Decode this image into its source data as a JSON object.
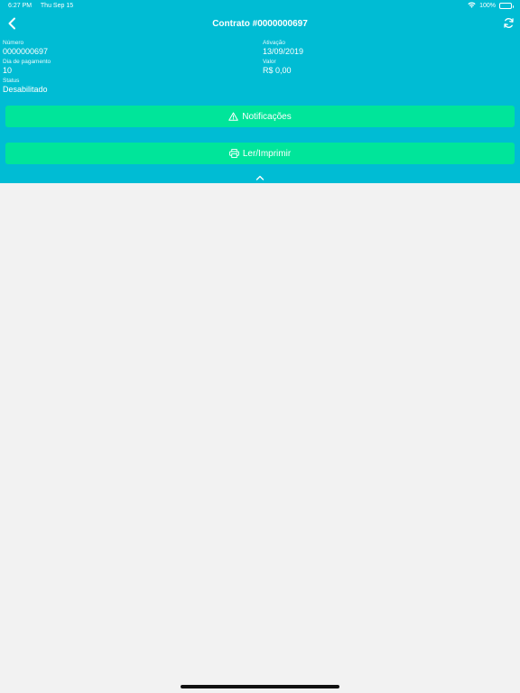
{
  "status_bar": {
    "time": "6:27 PM",
    "date": "Thu Sep 15",
    "battery": "100%",
    "battery_level": 1.0,
    "wifi_icon": "wifi-icon",
    "battery_icon": "battery-icon"
  },
  "nav": {
    "title": "Contrato #0000000697",
    "back_icon": "chevron-left-icon",
    "refresh_icon": "refresh-icon"
  },
  "contract": {
    "numero": {
      "label": "Número",
      "value": "0000000697"
    },
    "ativacao": {
      "label": "Ativação",
      "value": "13/09/2019"
    },
    "dia_pagamento": {
      "label": "Dia de pagamento",
      "value": "10"
    },
    "valor": {
      "label": "Valor",
      "value": "R$ 0,00"
    },
    "status": {
      "label": "Status",
      "value": "Desabilitado"
    }
  },
  "actions": {
    "notificacoes": {
      "label": "Notificações",
      "icon": "warning-icon"
    },
    "imprimir": {
      "label": "Ler/Imprimir",
      "icon": "printer-icon"
    }
  },
  "collapse_icon": "chevron-up-icon",
  "colors": {
    "header_bg": "#00bcd4",
    "button_bg": "#00e59a",
    "content_bg": "#f2f2f2",
    "text_light": "#ffffff"
  }
}
